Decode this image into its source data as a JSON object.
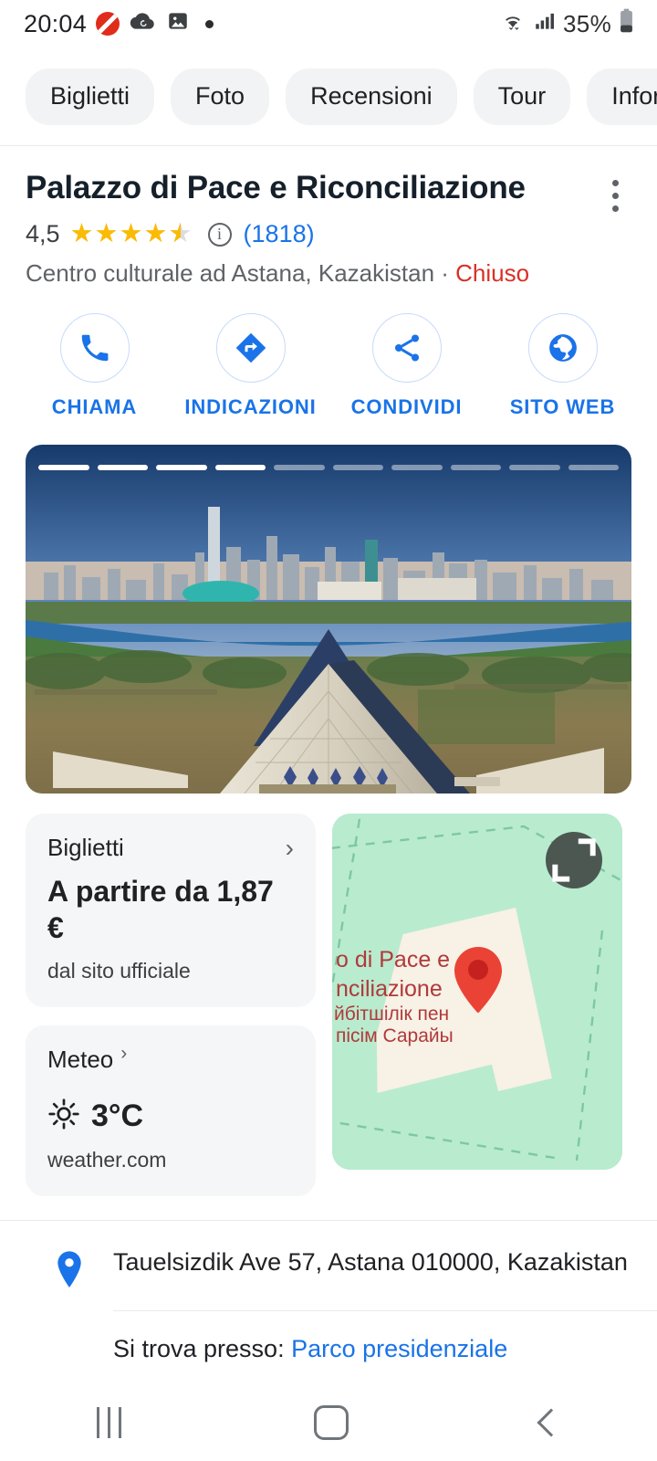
{
  "status_bar": {
    "time": "20:04",
    "battery_percent": "35%",
    "icons": [
      "dnd-icon",
      "cloud-sync-icon",
      "photo-icon",
      "dot-icon",
      "wifi-icon",
      "signal-icon",
      "battery-icon"
    ]
  },
  "chips": [
    {
      "label": "Biglietti"
    },
    {
      "label": "Foto"
    },
    {
      "label": "Recensioni"
    },
    {
      "label": "Tour"
    },
    {
      "label": "Informazioni"
    }
  ],
  "place": {
    "title": "Palazzo di Pace e Riconciliazione",
    "rating": "4,5",
    "stars": 4.5,
    "review_count": "(1818)",
    "category_line": "Centro culturale ad Astana, Kazakistan · ",
    "status": "Chiuso",
    "status_color": "#d93025"
  },
  "actions": [
    {
      "label": "CHIAMA",
      "icon": "phone-icon"
    },
    {
      "label": "INDICAZIONI",
      "icon": "directions-icon"
    },
    {
      "label": "CONDIVIDI",
      "icon": "share-icon"
    },
    {
      "label": "SITO WEB",
      "icon": "globe-icon"
    }
  ],
  "hero": {
    "alt": "Vista aerea del Palazzo di Pace e Riconciliazione con lo skyline di Astana",
    "carousel_total": 10,
    "carousel_active": 4
  },
  "tickets_card": {
    "title": "Biglietti",
    "price": "A partire da 1,87 €",
    "source": "dal sito ufficiale"
  },
  "weather_card": {
    "title": "Meteo",
    "temperature": "3°C",
    "source": "weather.com",
    "icon": "sun-icon"
  },
  "map_card": {
    "labels": [
      "o di Pace e",
      "nciliazione",
      "йбітшілік пен",
      "пісім Сарайы"
    ],
    "label_color": "#b03a3a",
    "park_color": "#b9ebcf",
    "building_color": "#f7f1e6",
    "pin_color": "#ea4335",
    "expand_icon": "expand-icon"
  },
  "address": {
    "icon": "location-pin-icon",
    "text": "Tauelsizdik Ave 57, Astana 010000, Kazakistan"
  },
  "located_in": {
    "prefix": "Si trova presso: ",
    "link": "Parco presidenziale"
  },
  "nav_bar": {
    "recents": "recents-button",
    "home": "home-button",
    "back": "back-button"
  },
  "colors": {
    "accent": "#1a73e8",
    "chip_bg": "#f1f3f4",
    "card_bg": "#f5f6f7",
    "star": "#fabb05"
  }
}
